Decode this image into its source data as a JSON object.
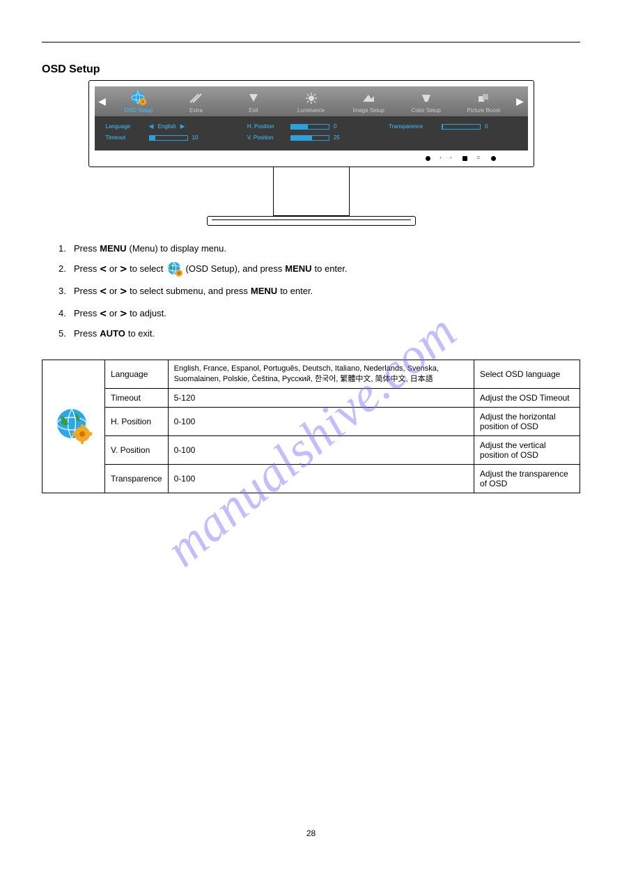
{
  "section_title": "OSD Setup",
  "watermark": "manualshive.com",
  "page_number": "28",
  "osd": {
    "tabs": [
      {
        "label": "OSD Setup",
        "active": true
      },
      {
        "label": "Extra"
      },
      {
        "label": "Exit"
      },
      {
        "label": "Luminance"
      },
      {
        "label": "Image Setup"
      },
      {
        "label": "Color Setup"
      },
      {
        "label": "Picture Boost"
      }
    ],
    "rows": {
      "language": {
        "label": "Language",
        "value": "English"
      },
      "timeout": {
        "label": "Timeout",
        "value": "10",
        "pct": 15
      },
      "hpos": {
        "label": "H. Position",
        "value": "0",
        "pct": 45
      },
      "vpos": {
        "label": "V. Position",
        "value": "25",
        "pct": 55
      },
      "transparence": {
        "label": "Transparence",
        "value": "0",
        "pct": 0
      }
    }
  },
  "instructions": {
    "l1_a": "1.",
    "l1_b": "Press",
    "l1_c": "(Menu) to display menu.",
    "l2_a": "2.",
    "l2_b": "Press",
    "l2_c": "or",
    "l2_d": " to select",
    "l2_e": "(OSD Setup), and press",
    "l2_f": "to enter.",
    "l3_a": "3.",
    "l3_b": "Press",
    "l3_c": "or",
    "l3_d": "to select submenu, and press",
    "l3_e": "to enter.",
    "l4_a": "4.",
    "l4_b": "Press",
    "l4_c": "or",
    "l4_d": "to adjust.",
    "l5_a": "5.",
    "l5_b": "Press",
    "l5_c": "to exit.",
    "menu_btn": "MENU",
    "auto_btn": "AUTO"
  },
  "table": {
    "r1c1": "Language",
    "r1c2": "English, France, Espanol, Português, Deutsch, Italiano, Nederlands, Svenska, Suomalainen, Polskie, Čeština, Pyccкий, 한국어, 繁體中文, 简体中文, 日本語",
    "r1c3": "Select OSD language",
    "r2c1": "Timeout",
    "r2c2": "5-120",
    "r2c3": "Adjust the OSD Timeout",
    "r3c1": "H. Position",
    "r3c2": "0-100",
    "r3c3": "Adjust  the  horizontal  position  of OSD",
    "r4c1": "V. Position",
    "r4c2": "0-100",
    "r4c3": "Adjust the vertical position of OSD",
    "r5c1": "Transparence",
    "r5c2": "0-100",
    "r5c3": "Adjust  the  transparence  of  OSD"
  }
}
